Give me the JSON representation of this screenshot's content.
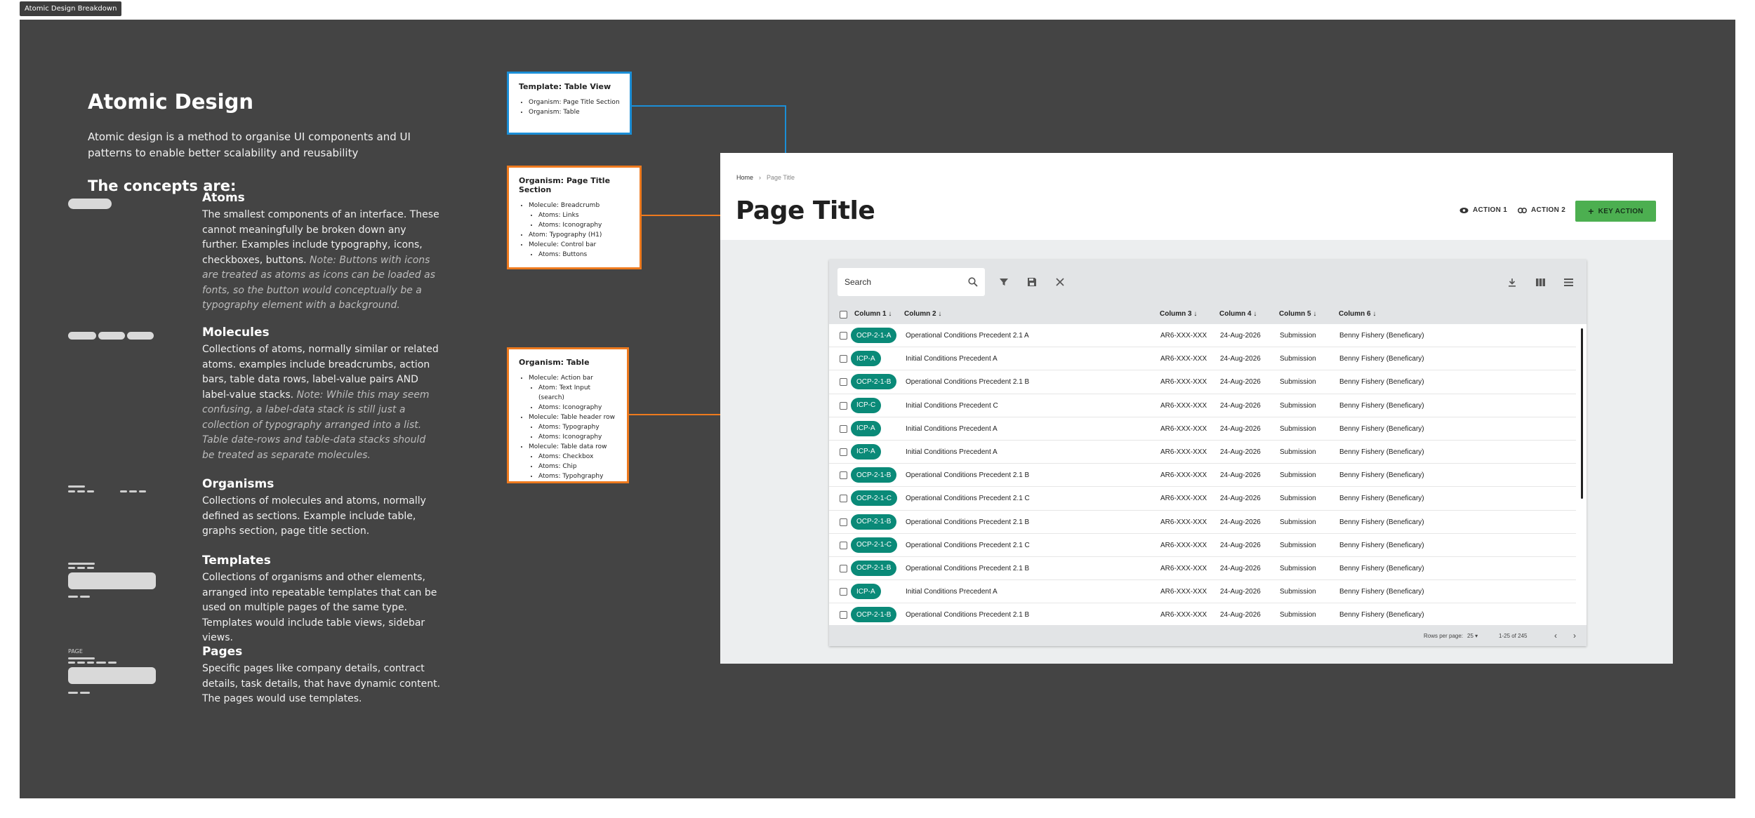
{
  "frame_tag": "Atomic Design Breakdown",
  "intro": {
    "title": "Atomic Design",
    "description": "Atomic design is a method to organise UI components and UI patterns to enable better scalability and reusability",
    "concepts_heading": "The concepts are:"
  },
  "concepts": [
    {
      "name": "Atoms",
      "text": "The smallest components of an interface. These cannot meaningfully be broken down any further. Examples include typography, icons, checkboxes, buttons. ",
      "note": "Note: Buttons with icons are treated as atoms as icons can be loaded as fonts, so the button would conceptually be a typography element with a background."
    },
    {
      "name": "Molecules",
      "text": "Collections of atoms, normally similar or related atoms. examples include breadcrumbs, action bars, table data rows, label-value pairs AND label-value stacks. ",
      "note": "Note: While this may seem confusing, a label-data stack is still just a collection of typography arranged into a list. Table date-rows and table-data stacks should be treated as separate molecules."
    },
    {
      "name": "Organisms",
      "text": "Collections of molecules and atoms, normally defined as sections. Example include table, graphs section, page title section.",
      "note": ""
    },
    {
      "name": "Templates",
      "text": "Collections of organisms and other elements, arranged into repeatable templates that can be used on multiple pages of the same type. Templates would include table views, sidebar views.",
      "note": ""
    },
    {
      "name": "Pages",
      "text": "Specific pages like company details, contract details, task details, that have dynamic content. The pages would use templates.",
      "note": ""
    }
  ],
  "pages_icon_label": "PAGE",
  "annotations": {
    "template": {
      "title": "Template: Table View",
      "items": [
        "Organism: Page Title Section",
        "Organism: Table"
      ]
    },
    "page_title": {
      "title": "Organism: Page Title Section",
      "items": [
        "Molecule: Breadcrumb",
        "Atoms: Links",
        "Atoms: Iconography",
        "Atom: Typography (H1)",
        "Molecule: Control bar",
        "Atoms: Buttons"
      ]
    },
    "table": {
      "title": "Organism: Table",
      "items": [
        "Molecule: Action bar",
        "Atom: Text Input (search)",
        "Atoms: Iconography",
        "Molecule: Table header row",
        "Atoms: Typography",
        "Atoms: Iconography",
        "Molecule: Table data row",
        "Atoms: Checkbox",
        "Atoms: Chip",
        "Atoms: Typohgraphy"
      ]
    }
  },
  "mock": {
    "breadcrumb": {
      "home": "Home",
      "current": "Page Title"
    },
    "page_title": "Page Title",
    "actions": {
      "action1": "ACTION 1",
      "action2": "ACTION 2",
      "key": "KEY ACTION"
    },
    "search_placeholder": "Search",
    "columns": [
      "Column 1",
      "Column 2",
      "Column 3",
      "Column 4",
      "Column 5",
      "Column 6"
    ],
    "rows": [
      [
        "OCP-2-1-A",
        "Operational Conditions Precedent 2.1 A",
        "AR6-XXX-XXX",
        "24-Aug-2026",
        "Submission",
        "Benny Fishery (Beneficary)"
      ],
      [
        "ICP-A",
        "Initial Conditions Precedent A",
        "AR6-XXX-XXX",
        "24-Aug-2026",
        "Submission",
        "Benny Fishery (Beneficary)"
      ],
      [
        "OCP-2-1-B",
        "Operational Conditions Precedent 2.1 B",
        "AR6-XXX-XXX",
        "24-Aug-2026",
        "Submission",
        "Benny Fishery (Beneficary)"
      ],
      [
        "ICP-C",
        "Initial Conditions Precedent C",
        "AR6-XXX-XXX",
        "24-Aug-2026",
        "Submission",
        "Benny Fishery (Beneficary)"
      ],
      [
        "ICP-A",
        "Initial Conditions Precedent A",
        "AR6-XXX-XXX",
        "24-Aug-2026",
        "Submission",
        "Benny Fishery (Beneficary)"
      ],
      [
        "ICP-A",
        "Initial Conditions Precedent A",
        "AR6-XXX-XXX",
        "24-Aug-2026",
        "Submission",
        "Benny Fishery (Beneficary)"
      ],
      [
        "OCP-2-1-B",
        "Operational Conditions Precedent 2.1 B",
        "AR6-XXX-XXX",
        "24-Aug-2026",
        "Submission",
        "Benny Fishery (Beneficary)"
      ],
      [
        "OCP-2-1-C",
        "Operational Conditions Precedent 2.1 C",
        "AR6-XXX-XXX",
        "24-Aug-2026",
        "Submission",
        "Benny Fishery (Beneficary)"
      ],
      [
        "OCP-2-1-B",
        "Operational Conditions Precedent 2.1 B",
        "AR6-XXX-XXX",
        "24-Aug-2026",
        "Submission",
        "Benny Fishery (Beneficary)"
      ],
      [
        "OCP-2-1-C",
        "Operational Conditions Precedent 2.1 C",
        "AR6-XXX-XXX",
        "24-Aug-2026",
        "Submission",
        "Benny Fishery (Beneficary)"
      ],
      [
        "OCP-2-1-B",
        "Operational Conditions Precedent 2.1 B",
        "AR6-XXX-XXX",
        "24-Aug-2026",
        "Submission",
        "Benny Fishery (Beneficary)"
      ],
      [
        "ICP-A",
        "Initial Conditions Precedent A",
        "AR6-XXX-XXX",
        "24-Aug-2026",
        "Submission",
        "Benny Fishery (Beneficary)"
      ],
      [
        "OCP-2-1-B",
        "Operational Conditions Precedent 2.1 B",
        "AR6-XXX-XXX",
        "24-Aug-2026",
        "Submission",
        "Benny Fishery (Beneficary)"
      ]
    ],
    "footer": {
      "rows_label": "Rows per page:",
      "rows_value": "25",
      "range": "1-25 of 245"
    },
    "colors": {
      "chip": "#0a8a78",
      "key_action": "#4caf50",
      "blue_annotation": "#1b8ed6",
      "orange_annotation": "#ee7a1e"
    }
  }
}
